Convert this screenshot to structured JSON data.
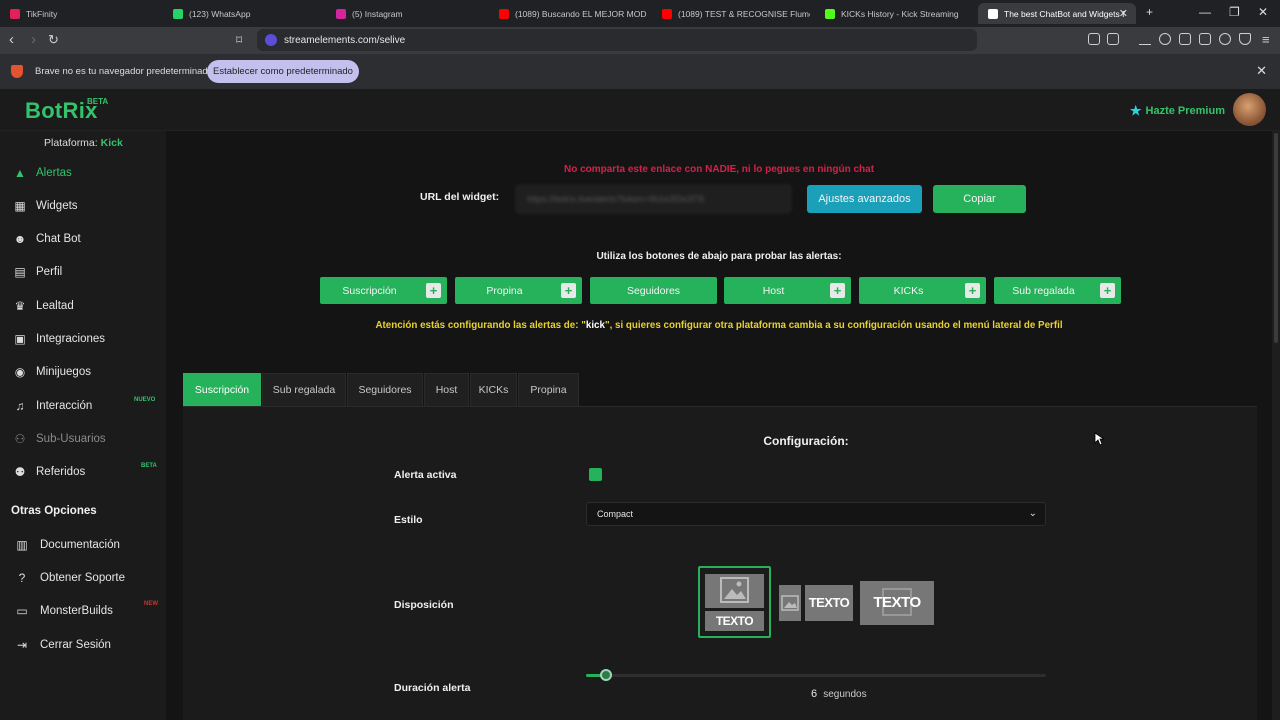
{
  "browser": {
    "tabs": [
      {
        "title": "TikFinity",
        "icon_color": "#e2205a"
      },
      {
        "title": "(123) WhatsApp",
        "icon_color": "#25d366"
      },
      {
        "title": "(5) Instagram",
        "icon_color": "#d6249f"
      },
      {
        "title": "(1089) Buscando EL MEJOR MOD NU",
        "icon_color": "#ff0000"
      },
      {
        "title": "(1089) TEST & RECOGNISE Flume Re",
        "icon_color": "#ff0000"
      },
      {
        "title": "KICKs History - Kick Streaming",
        "icon_color": "#53fc18"
      },
      {
        "title": "The best ChatBot and Widgets f",
        "icon_color": "#ffffff"
      }
    ],
    "url": "streamelements.com/selive",
    "infobar_message": "Brave no es tu navegador predeterminado",
    "infobar_button": "Establecer como predeterminado"
  },
  "app": {
    "logo": "BotRix",
    "logo_badge": "BETA",
    "premium_label": "Hazte Premium",
    "platform_label": "Plataforma:",
    "platform_value": "Kick",
    "accent": "#26b25a"
  },
  "sidebar": {
    "items": [
      {
        "label": "Alertas",
        "icon": "warning-icon"
      },
      {
        "label": "Widgets",
        "icon": "grid-icon"
      },
      {
        "label": "Chat Bot",
        "icon": "robot-icon"
      },
      {
        "label": "Perfil",
        "icon": "id-card-icon"
      },
      {
        "label": "Lealtad",
        "icon": "trophy-icon"
      },
      {
        "label": "Integraciones",
        "icon": "plugin-icon"
      },
      {
        "label": "Minijuegos",
        "icon": "gamepad-icon"
      },
      {
        "label": "Interacción",
        "icon": "music-icon",
        "badge": "NUEVO"
      },
      {
        "label": "Sub-Usuarios",
        "icon": "users-icon"
      },
      {
        "label": "Referidos",
        "icon": "people-icon",
        "badge": "BETA"
      }
    ],
    "other_heading": "Otras Opciones",
    "other_items": [
      {
        "label": "Documentación",
        "icon": "book-icon"
      },
      {
        "label": "Obtener Soporte",
        "icon": "help-icon"
      },
      {
        "label": "MonsterBuilds",
        "icon": "monitor-icon",
        "badge": "NEW"
      },
      {
        "label": "Cerrar Sesión",
        "icon": "logout-icon"
      }
    ]
  },
  "main": {
    "warning": "No comparta este enlace con NADIE, ni lo pegues en ningún chat",
    "url_label": "URL del widget:",
    "url_value": "https://botrix.live/alerts?token=9b1e3f2e2f78",
    "advanced_button": "Ajustes avanzados",
    "copy_button": "Copiar",
    "test_text": "Utiliza los botones de abajo para probar las alertas:",
    "test_buttons": [
      "Suscripción",
      "Propina",
      "Seguidores",
      "Host",
      "KICKs",
      "Sub regalada"
    ],
    "attention_prefix": "Atención estás configurando las alertas de: \"",
    "attention_platform": "kick",
    "attention_suffix": "\", si quieres configurar otra plataforma cambia a su configuración usando el menú lateral de Perfil",
    "tabs": [
      "Suscripción",
      "Sub regalada",
      "Seguidores",
      "Host",
      "KICKs",
      "Propina"
    ],
    "config_title": "Configuración:",
    "alert_active_label": "Alerta activa",
    "alert_active": true,
    "style_label": "Estilo",
    "style_value": "Compact",
    "layout_label": "Disposición",
    "layout_text": "TEXTO",
    "layout_selected": 0,
    "duration_label": "Duración alerta",
    "duration_value": "6",
    "duration_unit": "segundos",
    "duration_fraction": 0.043
  }
}
